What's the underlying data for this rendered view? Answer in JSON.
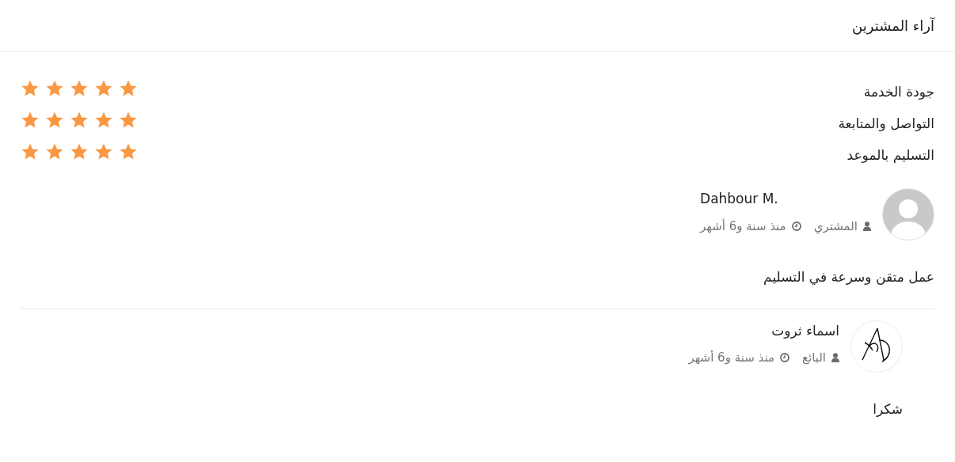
{
  "header": {
    "title": "آراء المشترين"
  },
  "ratings": [
    {
      "label": "جودة الخدمة",
      "stars": 5
    },
    {
      "label": "التواصل والمتابعة",
      "stars": 5
    },
    {
      "label": "التسليم بالموعد",
      "stars": 5
    }
  ],
  "reviews": [
    {
      "kind": "buyer",
      "name": "Dahbour M.",
      "role": "المشتري",
      "time": "منذ سنة و6 أشهر",
      "comment": "عمل متقن وسرعة في التسليم"
    },
    {
      "kind": "seller",
      "name": "اسماء ثروت",
      "role": "البائع",
      "time": "منذ سنة و6 أشهر",
      "comment": "شكرا"
    }
  ]
}
